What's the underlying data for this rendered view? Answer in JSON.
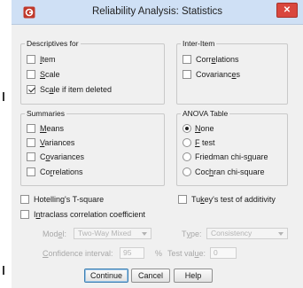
{
  "dialog": {
    "title": "Reliability Analysis: Statistics",
    "close_glyph": "✕"
  },
  "descriptives": {
    "legend": "Descriptives for",
    "items": [
      {
        "pre": "",
        "u": "I",
        "post": "tem",
        "checked": false
      },
      {
        "pre": "",
        "u": "S",
        "post": "cale",
        "checked": false
      },
      {
        "pre": "Sc",
        "u": "a",
        "post": "le if item deleted",
        "checked": true
      }
    ]
  },
  "inter_item": {
    "legend": "Inter-Item",
    "items": [
      {
        "pre": "Corr",
        "u": "e",
        "post": "lations",
        "checked": false
      },
      {
        "pre": "Covarianc",
        "u": "e",
        "post": "s",
        "checked": false
      }
    ]
  },
  "summaries": {
    "legend": "Summaries",
    "items": [
      {
        "pre": "",
        "u": "M",
        "post": "eans",
        "checked": false
      },
      {
        "pre": "",
        "u": "V",
        "post": "ariances",
        "checked": false
      },
      {
        "pre": "C",
        "u": "o",
        "post": "variances",
        "checked": false
      },
      {
        "pre": "Co",
        "u": "r",
        "post": "relations",
        "checked": false
      }
    ]
  },
  "anova": {
    "legend": "ANOVA Table",
    "options": [
      {
        "pre": "",
        "u": "N",
        "post": "one",
        "selected": true
      },
      {
        "pre": "",
        "u": "F",
        "post": " test",
        "selected": false
      },
      {
        "pre": "Friedman chi-s",
        "u": "q",
        "post": "uare",
        "selected": false
      },
      {
        "pre": "Coc",
        "u": "h",
        "post": "ran chi-square",
        "selected": false
      }
    ]
  },
  "extra": {
    "hotelling": {
      "pre": "Hotelling's T-square",
      "u": "",
      "post": "",
      "checked": false
    },
    "tukey": {
      "pre": "Tu",
      "u": "k",
      "post": "ey's test of additivity",
      "checked": false
    },
    "intraclass": {
      "pre": "I",
      "u": "n",
      "post": "traclass correlation coefficient",
      "checked": false
    }
  },
  "icc": {
    "model_label_pre": "Mod",
    "model_label_u": "e",
    "model_label_post": "l:",
    "model_value": "Two-Way Mixed",
    "type_label_pre": "T",
    "type_label_u": "y",
    "type_label_post": "pe:",
    "type_value": "Consistency",
    "ci_label_pre": "",
    "ci_label_u": "C",
    "ci_label_post": "onfidence interval:",
    "ci_value": "95",
    "ci_unit": "%",
    "test_label_pre": "Test val",
    "test_label_u": "u",
    "test_label_post": "e:",
    "test_value": "0"
  },
  "buttons": {
    "continue": "Continue",
    "cancel": "Cancel",
    "help": "Help"
  }
}
